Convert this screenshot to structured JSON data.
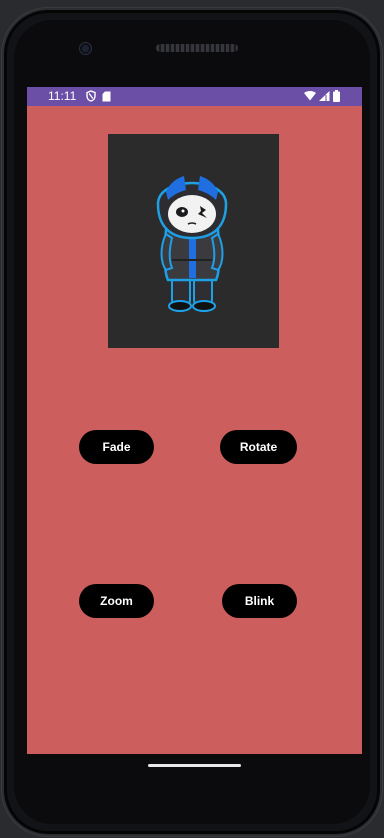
{
  "status_bar": {
    "time": "11:11",
    "left_icons": [
      "shield-icon",
      "sim-card-icon"
    ],
    "right_icons": [
      "wifi-icon",
      "signal-icon",
      "battery-icon"
    ],
    "color": "#6b4fa6"
  },
  "app": {
    "background_color": "#cc5e5d",
    "image": {
      "subject": "character-illustration",
      "frame_color": "#2b2b2b"
    },
    "buttons": {
      "fade": "Fade",
      "rotate": "Rotate",
      "zoom": "Zoom",
      "blink": "Blink"
    },
    "button_color": "#000000",
    "button_text_color": "#ffffff"
  }
}
